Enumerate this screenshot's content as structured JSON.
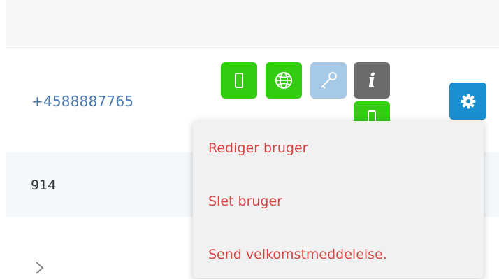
{
  "user_row": {
    "phone": "+4588887765",
    "id_value": "914"
  },
  "status_icons": {
    "mobile": "mobile-phone-icon",
    "globe": "globe-icon",
    "key": "key-icon",
    "info": "info-icon",
    "info_glyph": "i",
    "settings": "gear-icon"
  },
  "dropdown_menu": {
    "items": [
      {
        "label": "Rediger bruger"
      },
      {
        "label": "Slet bruger"
      },
      {
        "label": "Send velkomstmeddelelse."
      }
    ]
  },
  "colors": {
    "active_green": "#33cc11",
    "inactive_light_blue": "#a7c9e8",
    "info_gray": "#6b6b6b",
    "settings_blue": "#1a8fd0",
    "menu_text_red": "#d94545",
    "link_blue": "#4a78b0"
  }
}
